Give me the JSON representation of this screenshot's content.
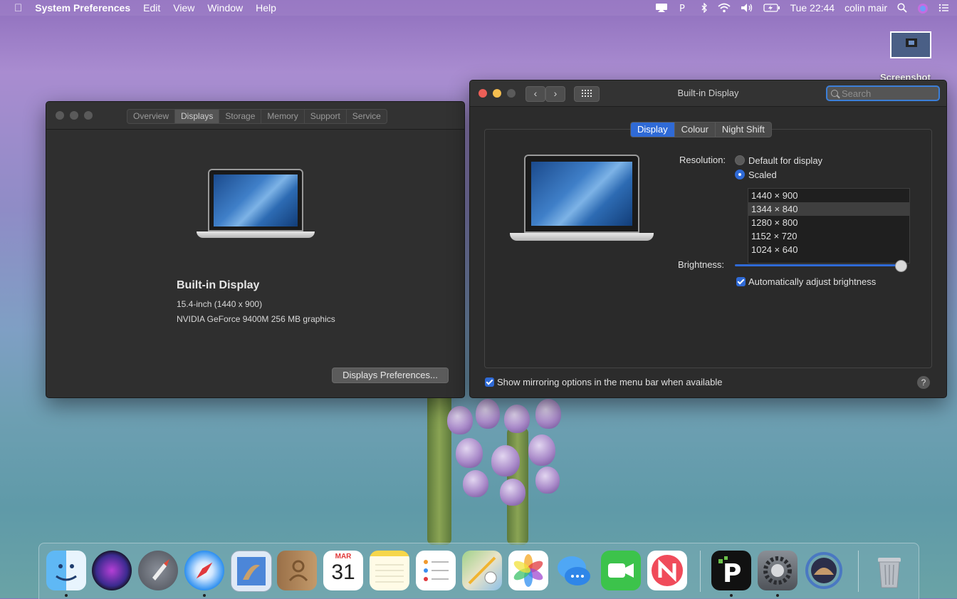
{
  "menubar": {
    "app_name": "System Preferences",
    "menus": [
      "Edit",
      "View",
      "Window",
      "Help"
    ],
    "clock": "Tue 22:44",
    "user": "colin mair"
  },
  "desktop": {
    "screenshot_label": "Screenshot"
  },
  "about_window": {
    "tabs": [
      "Overview",
      "Displays",
      "Storage",
      "Memory",
      "Support",
      "Service"
    ],
    "active_tab": "Displays",
    "display_name": "Built-in Display",
    "display_size": "15.4-inch (1440 x 900)",
    "graphics": "NVIDIA GeForce 9400M 256 MB graphics",
    "prefs_button": "Displays Preferences..."
  },
  "prefs_window": {
    "title": "Built-in Display",
    "search_placeholder": "Search",
    "tabs": [
      "Display",
      "Colour",
      "Night Shift"
    ],
    "active_tab": "Display",
    "resolution_label": "Resolution:",
    "option_default": "Default for display",
    "option_scaled": "Scaled",
    "selected_option": "Scaled",
    "resolutions": [
      "1440 × 900",
      "1344 × 840",
      "1280 × 800",
      "1152 × 720",
      "1024 × 640"
    ],
    "selected_resolution": "1344 × 840",
    "brightness_label": "Brightness:",
    "brightness_level": 1.0,
    "auto_brightness_label": "Automatically adjust brightness",
    "auto_brightness_checked": true,
    "mirroring_label": "Show mirroring options in the menu bar when available",
    "mirroring_checked": true,
    "help": "?"
  },
  "dock": {
    "calendar_month": "MAR",
    "calendar_day": "31",
    "apps": [
      "finder-icon",
      "siri-icon",
      "launchpad-icon",
      "safari-icon",
      "mail-icon",
      "contacts-icon",
      "calendar-icon",
      "notes-icon",
      "reminders-icon",
      "maps-icon",
      "photos-icon",
      "messages-icon",
      "facetime-icon",
      "news-icon",
      "ipvanish-icon",
      "system-preferences-icon",
      "time-machine-icon",
      "trash-icon"
    ]
  },
  "colors": {
    "accent": "#2f6ad6",
    "window_bg": "#2c2c2c",
    "close": "#ed5f57",
    "minimize": "#f5be4f",
    "zoom_inactive": "#5a5a5a"
  }
}
